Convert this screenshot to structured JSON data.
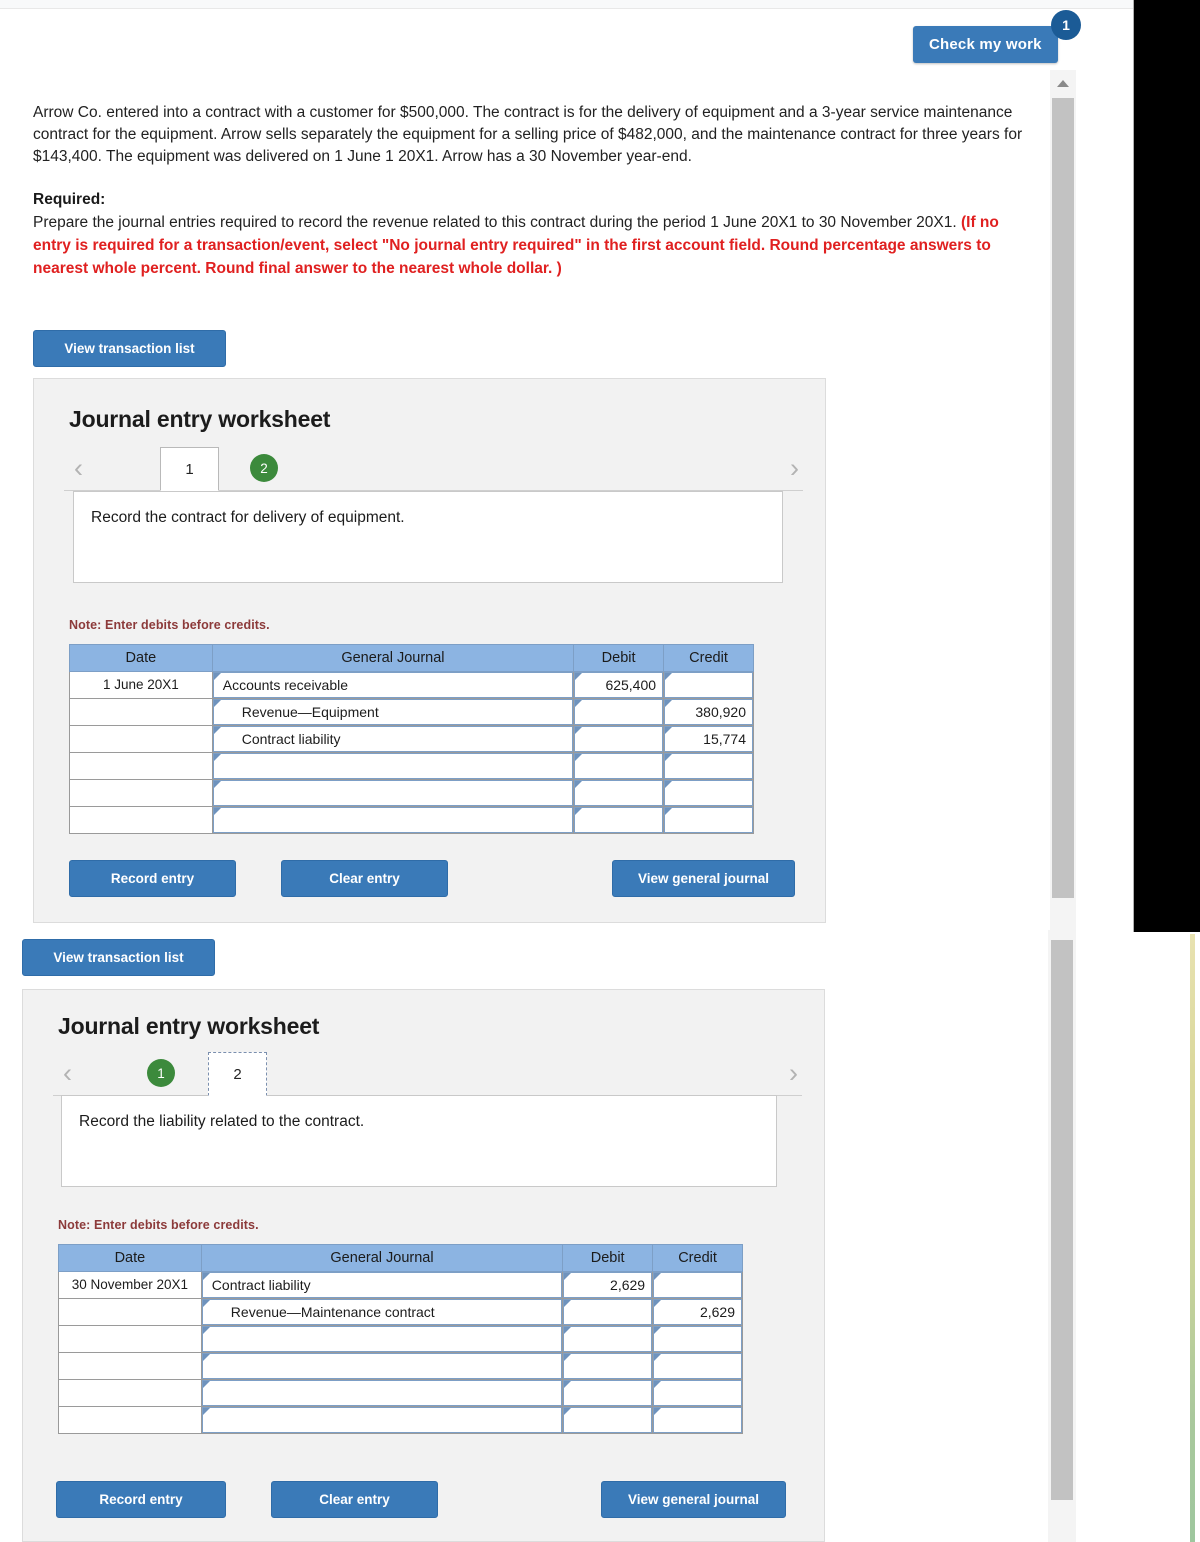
{
  "header": {
    "check_my_work_label": "Check my work",
    "check_my_work_badge": "1"
  },
  "problem": {
    "paragraph": "Arrow Co. entered into a contract with a customer for $500,000. The contract is for the delivery of equipment and a 3-year service maintenance contract for the equipment. Arrow sells separately the equipment for a selling price of $482,000, and the maintenance contract for three years for $143,400. The equipment was delivered on 1 June 1 20X1. Arrow has a 30 November year-end.",
    "required_label": "Required:",
    "required_text": "Prepare the journal entries required to record the revenue related to this contract during the period 1 June 20X1 to 30 November 20X1.",
    "required_note": "(If no entry is required for a transaction/event, select \"No journal entry required\" in the first account field. Round percentage answers to nearest whole percent. Round final answer to the nearest whole dollar. )"
  },
  "common": {
    "view_transaction_list": "View transaction list",
    "worksheet_title": "Journal entry worksheet",
    "note": "Note: Enter debits before credits.",
    "record_entry": "Record entry",
    "clear_entry": "Clear entry",
    "view_general_journal": "View general journal",
    "prev_icon": "‹",
    "next_icon": "›",
    "columns": [
      "Date",
      "General Journal",
      "Debit",
      "Credit"
    ]
  },
  "worksheet1": {
    "tabs": [
      {
        "label": "1",
        "state": "active"
      },
      {
        "label": "2",
        "state": "complete"
      }
    ],
    "description": "Record the contract for delivery of equipment.",
    "rows": [
      {
        "date": "1 June 20X1",
        "account": "Accounts receivable",
        "indent": false,
        "debit": "625,400",
        "credit": ""
      },
      {
        "date": "",
        "account": "Revenue—Equipment",
        "indent": true,
        "debit": "",
        "credit": "380,920"
      },
      {
        "date": "",
        "account": "Contract liability",
        "indent": true,
        "debit": "",
        "credit": "15,774"
      },
      {
        "date": "",
        "account": "",
        "indent": false,
        "debit": "",
        "credit": ""
      },
      {
        "date": "",
        "account": "",
        "indent": false,
        "debit": "",
        "credit": ""
      },
      {
        "date": "",
        "account": "",
        "indent": false,
        "debit": "",
        "credit": ""
      }
    ]
  },
  "worksheet2": {
    "tabs": [
      {
        "label": "1",
        "state": "complete"
      },
      {
        "label": "2",
        "state": "active"
      }
    ],
    "description": "Record the liability related to the contract.",
    "rows": [
      {
        "date": "30 November 20X1",
        "account": "Contract liability",
        "indent": false,
        "debit": "2,629",
        "credit": ""
      },
      {
        "date": "",
        "account": "Revenue—Maintenance contract",
        "indent": true,
        "debit": "",
        "credit": "2,629"
      },
      {
        "date": "",
        "account": "",
        "indent": false,
        "debit": "",
        "credit": ""
      },
      {
        "date": "",
        "account": "",
        "indent": false,
        "debit": "",
        "credit": ""
      },
      {
        "date": "",
        "account": "",
        "indent": false,
        "debit": "",
        "credit": ""
      },
      {
        "date": "",
        "account": "",
        "indent": false,
        "debit": "",
        "credit": ""
      }
    ]
  },
  "colors": {
    "button_blue": "#3a7ab8",
    "table_header_blue": "#8cb4e2",
    "tab_green": "#3c8a3c",
    "alert_red": "#e02020",
    "note_red": "#8c3a3a"
  }
}
